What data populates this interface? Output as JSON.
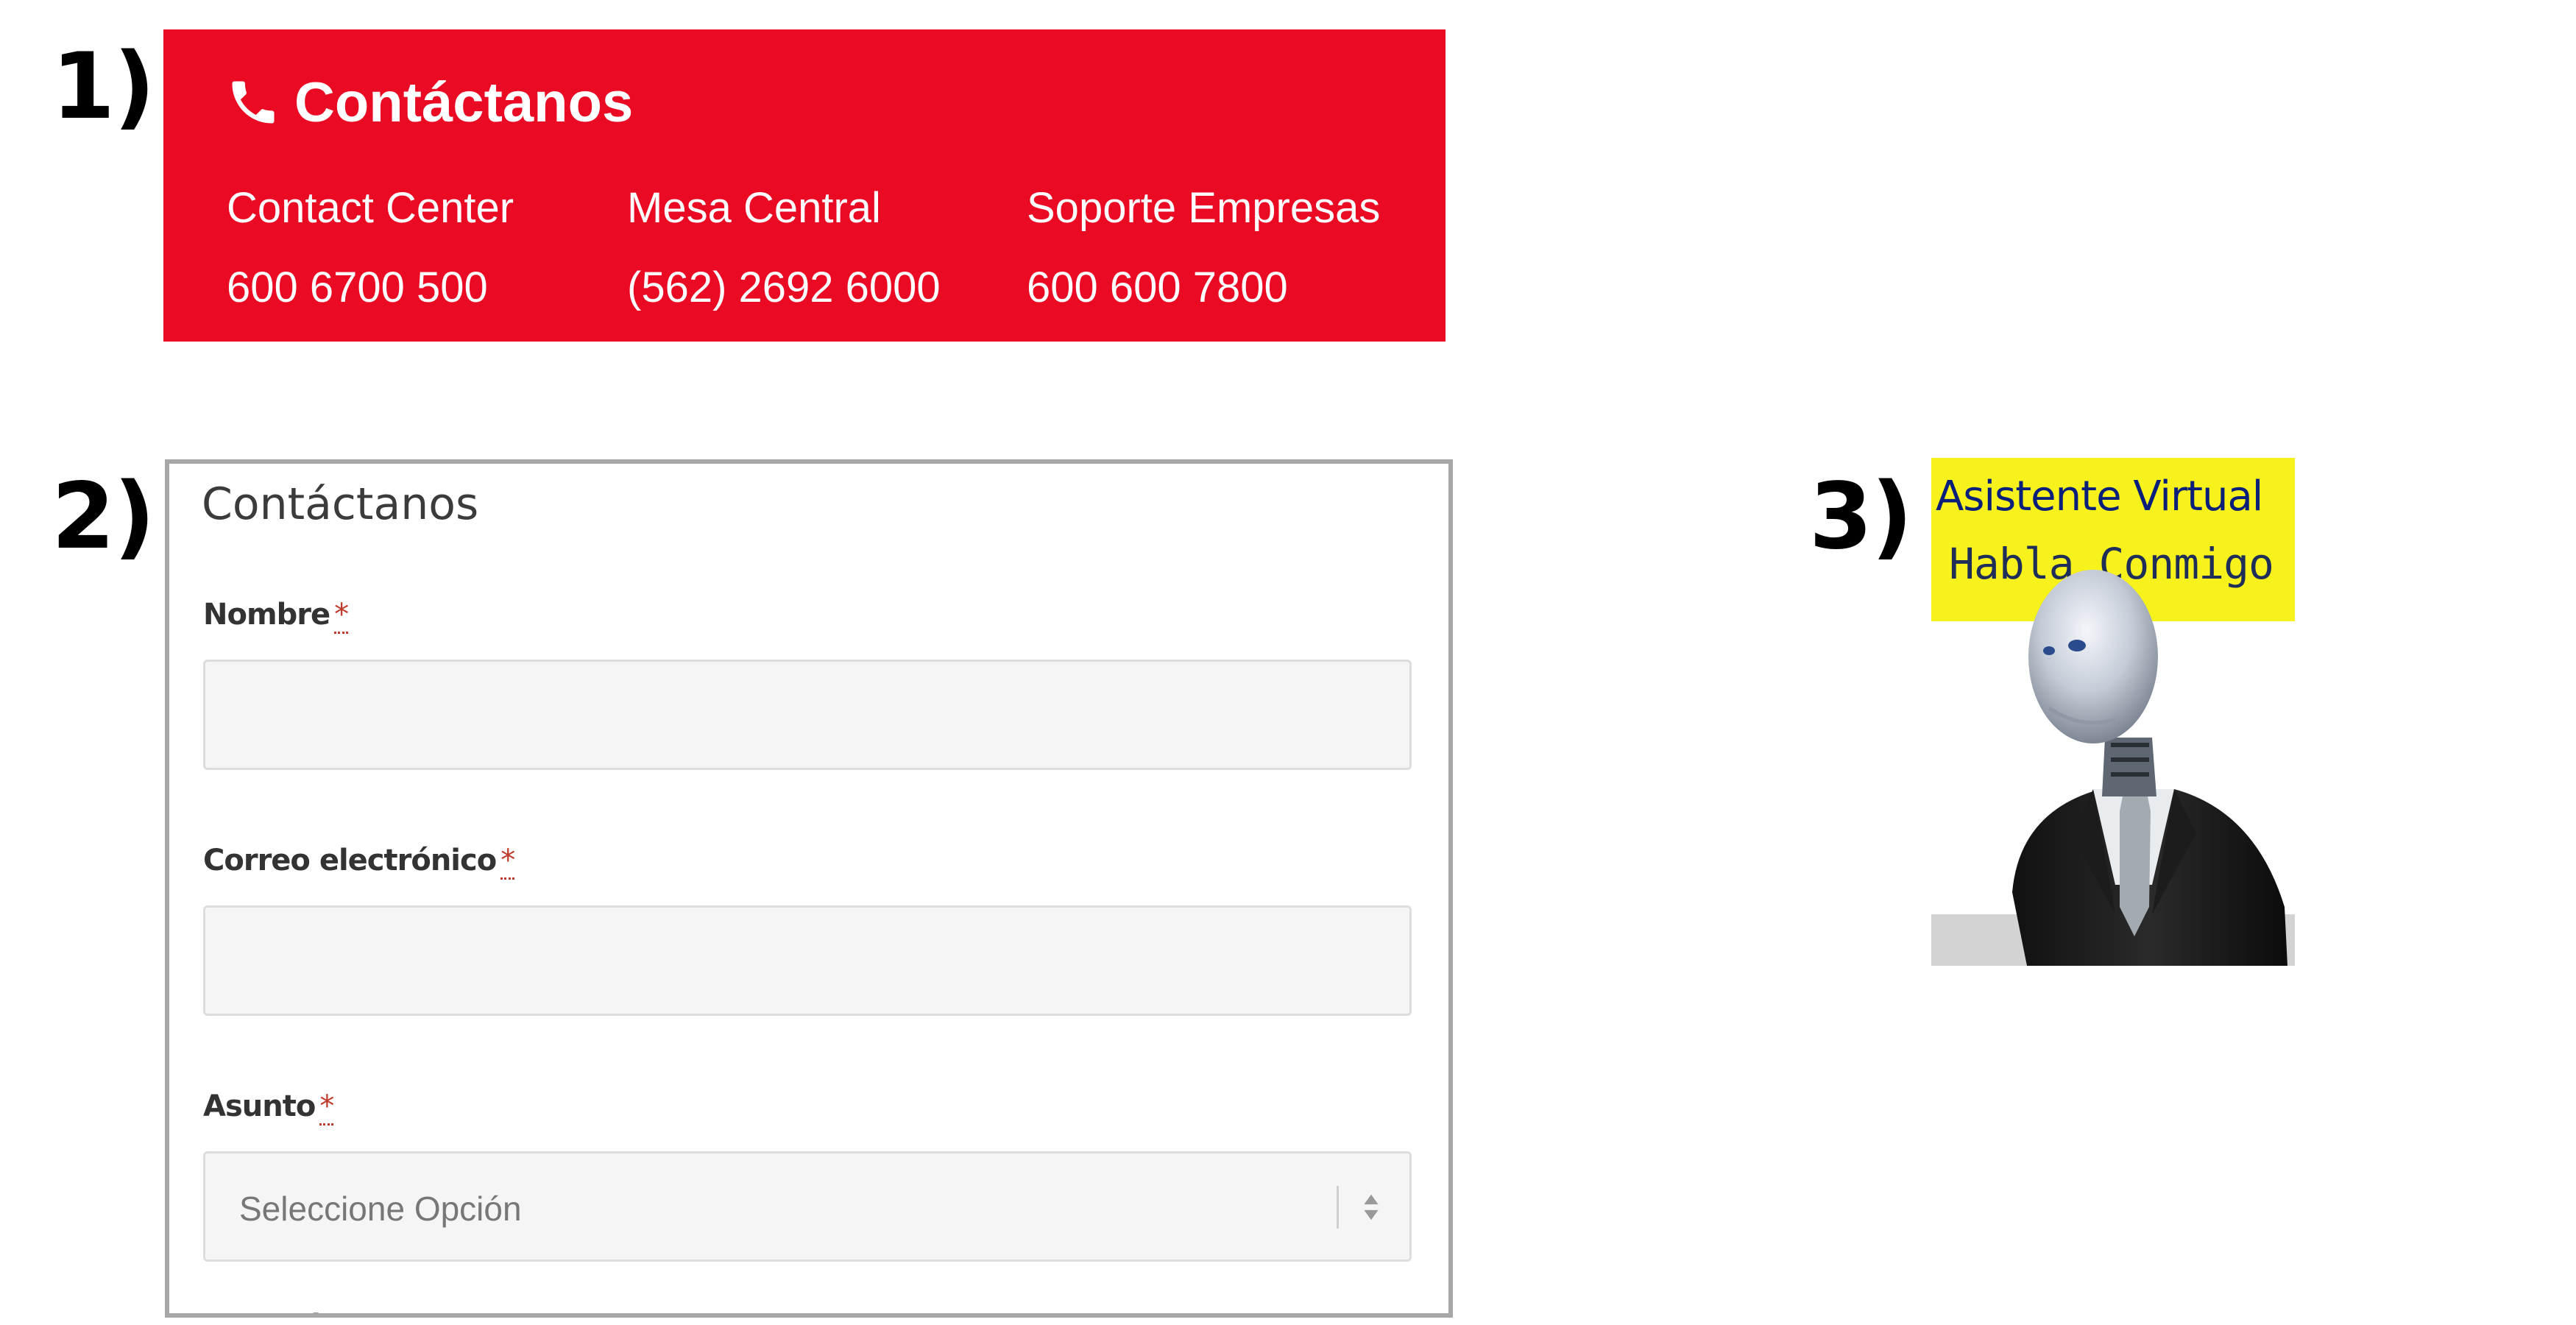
{
  "labels": {
    "one": "1)",
    "two": "2)",
    "three": "3)"
  },
  "banner": {
    "title": "Contáctanos",
    "icon": "phone-icon",
    "background": "#ea0a24",
    "columns": [
      {
        "label": "Contact Center",
        "number": "600 6700 500"
      },
      {
        "label": "Mesa Central",
        "number": "(562) 2692 6000"
      },
      {
        "label": "Soporte Empresas",
        "number": "600 600 7800"
      }
    ]
  },
  "form": {
    "title": "Contáctanos",
    "required_marker": "*",
    "fields": [
      {
        "label": "Nombre",
        "value": ""
      },
      {
        "label": "Correo electrónico",
        "value": ""
      },
      {
        "label": "Asunto",
        "value": "Seleccione Opción"
      }
    ],
    "next_label": "Mensaje"
  },
  "assistant": {
    "line1": "Asistente Virtual",
    "line2": "Habla Conmigo",
    "highlight_color": "#f7f21c",
    "icon": "robot-avatar"
  }
}
